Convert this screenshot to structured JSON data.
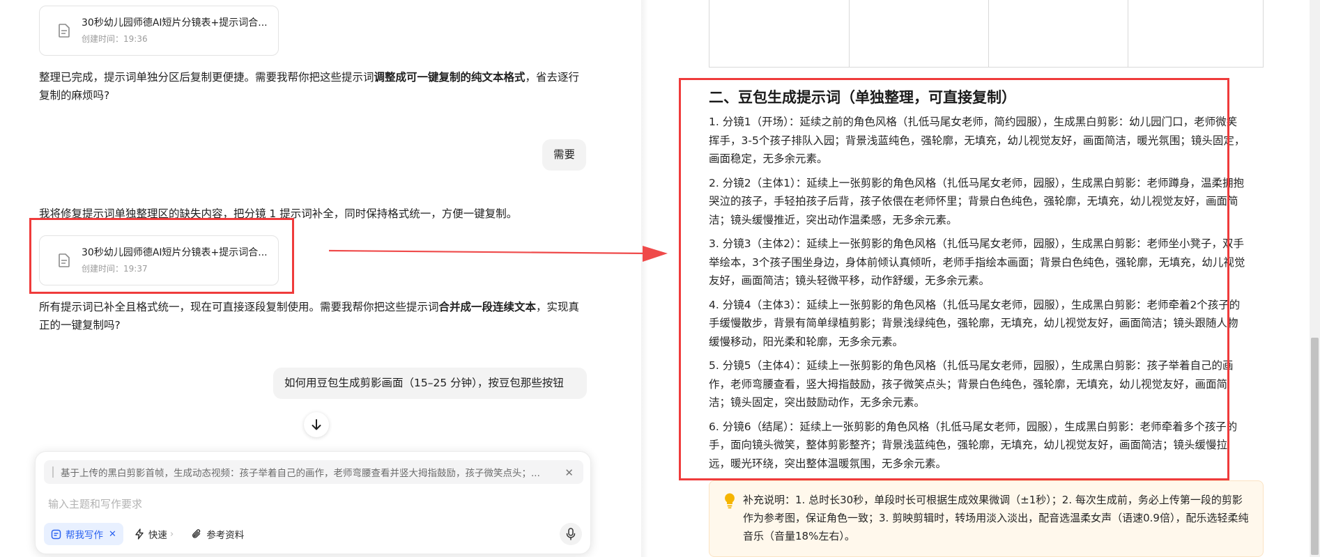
{
  "chat": {
    "file_card_1": {
      "name": "30秒幼儿园师德AI短片分镜表+提示词合...",
      "time": "创建时间：19:36"
    },
    "msg_1": {
      "pre": "整理已完成，提示词单独分区后复制更便捷。需要我帮你把这些提示词",
      "bold": "调整成可一键复制的纯文本格式",
      "post": "，省去逐行复制的麻烦吗?"
    },
    "user_1": "需要",
    "msg_2": "我将修复提示词单独整理区的缺失内容，把分镜 1 提示词补全，同时保持格式统一，方便一键复制。",
    "file_card_2": {
      "name": "30秒幼儿园师德AI短片分镜表+提示词合...",
      "time": "创建时间：19:37"
    },
    "msg_3": {
      "pre": "所有提示词已补全且格式统一，现在可直接逐段复制使用。需要我帮你把这些提示词",
      "bold": "合并成一段连续文本",
      "post": "，实现真正的一键复制吗?"
    },
    "user_2": "如何用豆包生成剪影画面（15–25 分钟），按豆包那些按钮"
  },
  "composer": {
    "quote": "基于上传的黑白剪影首帧，生成动态视频：孩子举着自己的画作，老师弯腰查看并竖大拇指鼓励，孩子微笑点头；...",
    "placeholder": "输入主题和写作要求",
    "tools": {
      "write": "帮我写作",
      "fast": "快速",
      "ref": "参考资料"
    }
  },
  "doc": {
    "heading": "二、豆包生成提示词（单独整理，可直接复制）",
    "items": [
      "1. 分镜1（开场）：延续之前的角色风格（扎低马尾女老师，简约园服），生成黑白剪影：幼儿园门口，老师微笑挥手，3-5个孩子排队入园；背景浅蓝纯色，强轮廓，无填充，幼儿视觉友好，画面简洁，暖光氛围；镜头固定，画面稳定，无多余元素。",
      "2. 分镜2（主体1）：延续上一张剪影的角色风格（扎低马尾女老师，园服），生成黑白剪影：老师蹲身，温柔拥抱哭泣的孩子，手轻拍孩子后背，孩子依偎在老师怀里；背景白色纯色，强轮廓，无填充，幼儿视觉友好，画面简洁；镜头缓慢推近，突出动作温柔感，无多余元素。",
      "3. 分镜3（主体2）：延续上一张剪影的角色风格（扎低马尾女老师，园服），生成黑白剪影：老师坐小凳子，双手举绘本，3个孩子围坐身边，身体前倾认真倾听，老师手指绘本画面；背景白色纯色，强轮廓，无填充，幼儿视觉友好，画面简洁；镜头轻微平移，动作舒缓，无多余元素。",
      "4. 分镜4（主体3）：延续上一张剪影的角色风格（扎低马尾女老师，园服），生成黑白剪影：老师牵着2个孩子的手缓慢散步，背景有简单绿植剪影；背景浅绿纯色，强轮廓，无填充，幼儿视觉友好，画面简洁；镜头跟随人物缓慢移动，阳光柔和轮廓，无多余元素。",
      "5. 分镜5（主体4）：延续上一张剪影的角色风格（扎低马尾女老师，园服），生成黑白剪影：孩子举着自己的画作，老师弯腰查看，竖大拇指鼓励，孩子微笑点头；背景白色纯色，强轮廓，无填充，幼儿视觉友好，画面简洁；镜头固定，突出鼓励动作，无多余元素。",
      "6. 分镜6（结尾）：延续上一张剪影的角色风格（扎低马尾女老师，园服），生成黑白剪影：老师牵着多个孩子的手，面向镜头微笑，整体剪影整齐；背景浅蓝纯色，强轮廓，无填充，幼儿视觉友好，画面简洁；镜头缓慢拉远，暖光环绕，突出整体温暖氛围，无多余元素。"
    ],
    "note": "补充说明：1. 总时长30秒，单段时长可根据生成效果微调（±1秒）；2. 每次生成前，务必上传第一段的剪影作为参考图，保证角色一致；3. 剪映剪辑时，转场用淡入淡出，配音选温柔女声（语速0.9倍），配乐选轻柔纯音乐（音量18%左右）。"
  },
  "colors": {
    "annotation_red": "#ef3b3b",
    "accent_blue": "#2a62f0",
    "note_bg": "#fff8ec"
  },
  "icons": [
    "document-icon",
    "arrow-down-icon",
    "close-icon",
    "write-icon",
    "lightning-icon",
    "paperclip-icon",
    "microphone-icon",
    "lightbulb-icon"
  ]
}
